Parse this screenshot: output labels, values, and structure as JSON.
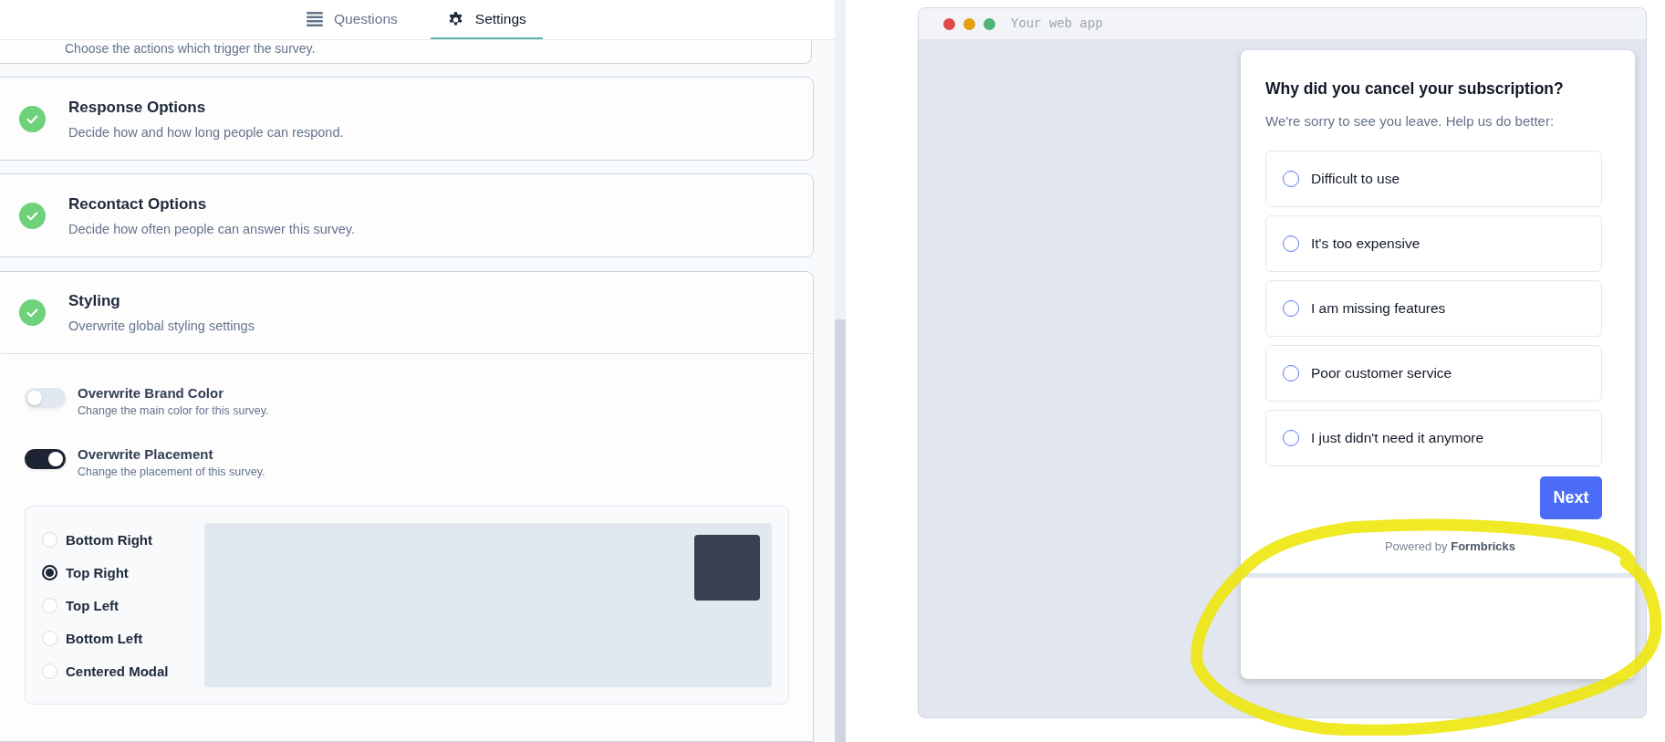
{
  "tabs": [
    {
      "label": "Questions",
      "selected": false
    },
    {
      "label": "Settings",
      "selected": true
    }
  ],
  "partial_card": {
    "description": "Choose the actions which trigger the survey."
  },
  "sections": [
    {
      "title": "Response Options",
      "description": "Decide how and how long people can respond.",
      "done": true
    },
    {
      "title": "Recontact Options",
      "description": "Decide how often people can answer this survey.",
      "done": true
    }
  ],
  "styling": {
    "title": "Styling",
    "description": "Overwrite global styling settings",
    "done": true,
    "toggles": [
      {
        "label": "Overwrite Brand Color",
        "description": "Change the main color for this survey.",
        "on": false
      },
      {
        "label": "Overwrite Placement",
        "description": "Change the placement of this survey.",
        "on": true
      }
    ],
    "placement": {
      "options": [
        {
          "label": "Bottom Right",
          "selected": false
        },
        {
          "label": "Top Right",
          "selected": true
        },
        {
          "label": "Top Left",
          "selected": false
        },
        {
          "label": "Bottom Left",
          "selected": false
        },
        {
          "label": "Centered Modal",
          "selected": false
        }
      ]
    }
  },
  "preview": {
    "window_title": "Your web app",
    "survey": {
      "question": "Why did you cancel your subscription?",
      "subtitle": "We're sorry to see you leave. Help us do better:",
      "choices": [
        {
          "label": "Difficult to use",
          "selected": false
        },
        {
          "label": "It's too expensive",
          "selected": false
        },
        {
          "label": "I am missing features",
          "selected": false
        },
        {
          "label": "Poor customer service",
          "selected": false
        },
        {
          "label": "I just didn't need it anymore",
          "selected": false
        }
      ],
      "button": "Next",
      "powered_by": "Powered by **Formbricks**"
    }
  }
}
